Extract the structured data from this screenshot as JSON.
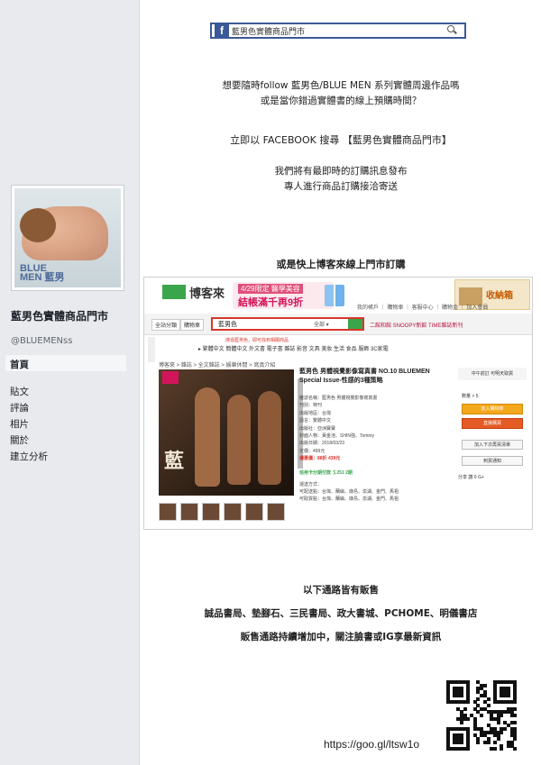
{
  "sidebar": {
    "cover_logo_line1": "BLUE",
    "cover_logo_line2": "MEN 藍男",
    "page_name": "藍男色實體商品門市",
    "handle": "@BLUEMENss",
    "nav": [
      "首頁",
      "貼文",
      "評論",
      "相片",
      "關於",
      "建立分析"
    ]
  },
  "search": {
    "fb_logo": "f",
    "query": "藍男色實體商品門市"
  },
  "intro": {
    "line1": "想要隨時follow 藍男色/BLUE MEN 系列實體周邊作品嗎",
    "line2": "或是當你錯過實體書的線上預購時間？",
    "cta": "立即以 FACEBOOK 搜尋 【藍男色實體商品門市】",
    "info1": "我們將有最即時的訂購訊息發布",
    "info2": "專人進行商品訂購接洽寄送",
    "shop_heading": "或是快上博客來線上門市訂購"
  },
  "bookstore": {
    "logo": "博客來",
    "banner_tag": "4/29限定 醫學美容",
    "banner_main": "結帳滿千再9折",
    "promo": "收納箱",
    "top_links": "我的帳戶 ｜ 購物車 ｜ 客服中心 ｜ 購物金 ｜ 加入會員",
    "tab_all": "全站分類",
    "tab_books": "購物車",
    "search_value": "藍男色",
    "search_category": "全部 ▾",
    "right_links": "二館和館 SNOOPY新館 TIME雜誌新刊",
    "hint": "搜尋藍男色，即可找到相關商品",
    "categories": "▸ 繁體中文  簡體中文  外文書  電子書  雜誌  影音  文具  美妝  生活  食品  服飾  3C家電",
    "crumb": "博客來 > 雜誌 > 全文雜誌 > 娛樂休閒 > 寫真介紹",
    "title": "藍男色 男體視覺影像寫真書 NO.10 BLUEMEN Special Issue-性感的3種策略",
    "meta": [
      "雜誌名稱：藍男色 男體視覺影像寫真書",
      "刊別：特刊",
      "出版地區：台灣",
      "語言：繁體中文",
      "出版社：亞洲寶寶",
      "封面人物：黃金池、SHIN強、Tommy",
      "出版日期：2018/03/23",
      "定價：499元"
    ],
    "price_line": "優惠價：88折 439元",
    "pay_head": "信用卡分期付款 ＄251 2期",
    "pay_lines": [
      "運送方式：",
      "可配送點：台灣、蘭嶼、綠島、澎湖、金門、馬祖",
      "可取貨點：台灣、蘭嶼、綠島、澎湖、金門、馬祖"
    ],
    "buy_head": "中午前訂 可明天取貨",
    "qty": "數量 > 5",
    "btn_cart": "放入購物車",
    "btn_buy": "直接購買",
    "btn_list": "加入下次再買清單",
    "btn_notify": "到貨通知",
    "share": "分享 讚 0  G+",
    "badge": "新品"
  },
  "retail": {
    "title": "以下通路皆有販售",
    "stores": "誠品書局、墊腳石、三民書局、政大書城、PCHOME、明儀書店",
    "note": "販售通路持續增加中，關注臉書或IG享最新資訊"
  },
  "qr": {
    "short_url": "https://goo.gl/ltsw1o"
  }
}
